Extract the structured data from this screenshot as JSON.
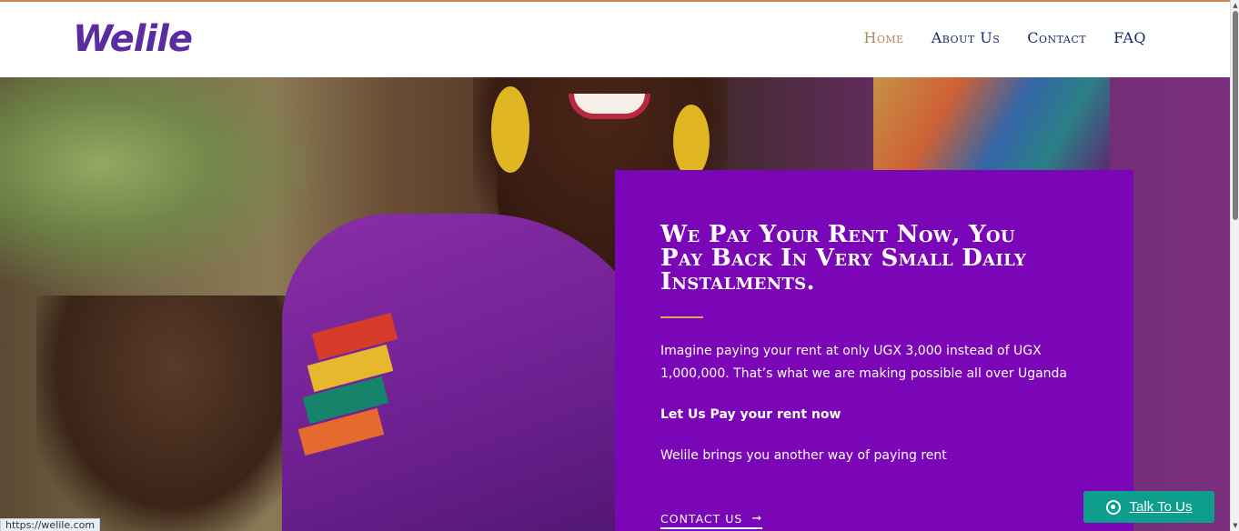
{
  "header": {
    "logo_text": "Welile",
    "nav": [
      {
        "label": "Home",
        "active": true
      },
      {
        "label": "About Us",
        "active": false
      },
      {
        "label": "Contact",
        "active": false
      },
      {
        "label": "FAQ",
        "active": false
      }
    ]
  },
  "hero": {
    "headline": "We Pay Your Rent Now, You Pay Back In Very Small Daily Instalments.",
    "paragraph_1": "Imagine paying your rent at only UGX 3,000 instead of UGX 1,000,000. That’s what we are making possible all over Uganda",
    "paragraph_2": "Let Us Pay your rent now",
    "paragraph_3": "Welile brings you another way of paying rent",
    "cta_label": "CONTACT US",
    "cta_arrow": "➞"
  },
  "floating": {
    "talk_label": "Talk To Us",
    "talk_icon": "whatsapp-icon"
  },
  "status_bar": {
    "url": "https://welile.com"
  },
  "colors": {
    "brand_purple": "#5a2ca0",
    "card_purple": "#7a06b8",
    "nav_active": "#b08850",
    "nav_text": "#1c2a6b",
    "whatsapp_teal": "#0e9e8e",
    "accent_rule": "#d8a85a"
  }
}
